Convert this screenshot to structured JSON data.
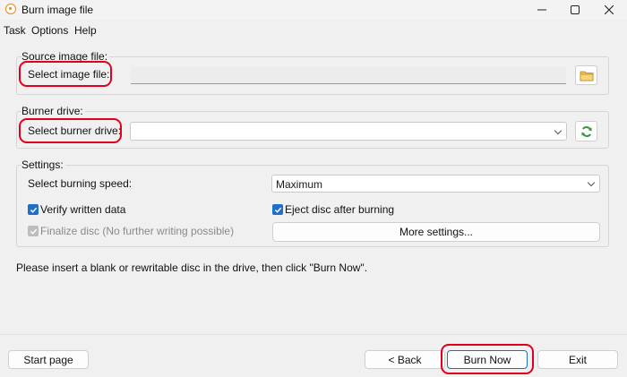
{
  "window": {
    "title": "Burn image file",
    "controls": [
      "minimize",
      "maximize",
      "close"
    ]
  },
  "menu": {
    "items": [
      "Task",
      "Options",
      "Help"
    ]
  },
  "source": {
    "group_label": "Source image file:",
    "field_label": "Select image file:",
    "value": "",
    "browse_icon": "folder-icon"
  },
  "burner": {
    "group_label": "Burner drive:",
    "field_label": "Select burner drive:",
    "selected": "",
    "refresh_icon": "refresh-icon"
  },
  "settings": {
    "group_label": "Settings:",
    "speed_label": "Select burning speed:",
    "speed_selected": "Maximum",
    "verify_label": "Verify written data",
    "verify_checked": true,
    "eject_label": "Eject disc after burning",
    "eject_checked": true,
    "finalize_label": "Finalize disc (No further writing possible)",
    "finalize_checked": true,
    "finalize_disabled": true,
    "more_settings_label": "More settings..."
  },
  "status_message": "Please insert a blank or rewritable disc in the drive, then click \"Burn Now\".",
  "footer": {
    "start_page_label": "Start page",
    "back_label": "< Back",
    "burn_now_label": "Burn Now",
    "exit_label": "Exit"
  },
  "colors": {
    "accent": "#1f6fc7",
    "annotation": "#e0001b",
    "refresh_green": "#2e9a3a",
    "folder_yellow": "#f2c14e"
  }
}
